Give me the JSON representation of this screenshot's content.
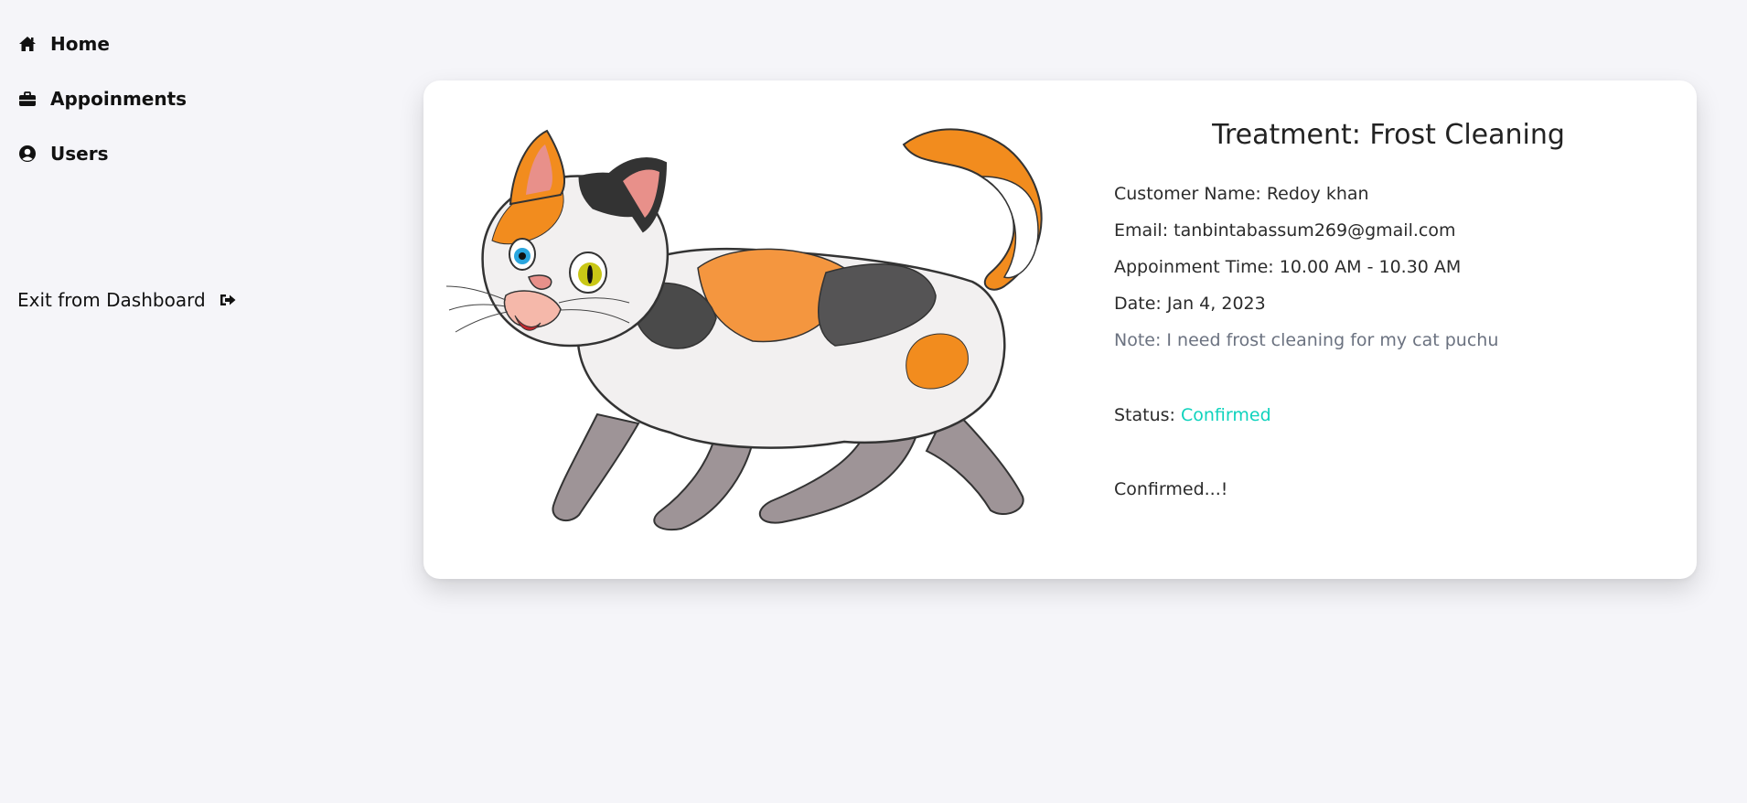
{
  "sidebar": {
    "items": [
      {
        "label": "Home",
        "icon": "home-icon"
      },
      {
        "label": "Appoinments",
        "icon": "briefcase-icon"
      },
      {
        "label": "Users",
        "icon": "user-circle-icon"
      }
    ],
    "exit_label": "Exit from Dashboard",
    "exit_icon": "sign-out-icon"
  },
  "appointment": {
    "title": "Treatment: Frost Cleaning",
    "customer_name": "Customer Name: Redoy khan",
    "email": "Email: tanbintabassum269@gmail.com",
    "time": "Appoinment Time: 10.00 AM - 10.30 AM",
    "date": "Date: Jan 4, 2023",
    "note": "Note: I need frost cleaning for my cat puchu",
    "status_label": "Status: ",
    "status_value": "Confirmed",
    "status_color": "#0fd3bd",
    "confirmed_message": "Confirmed...!"
  }
}
